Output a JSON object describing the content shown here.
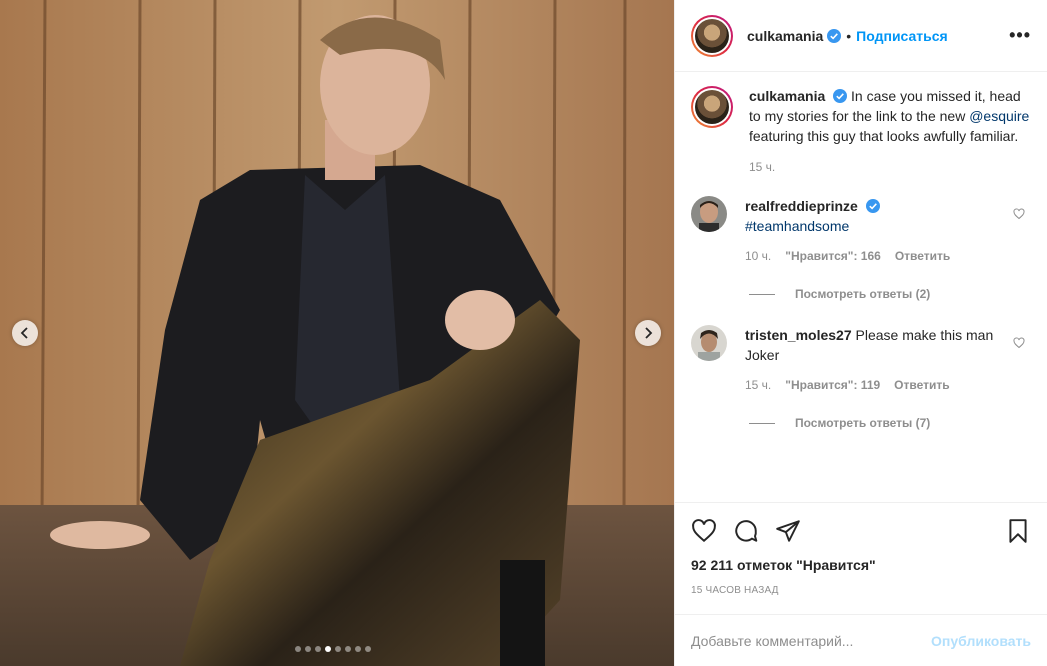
{
  "post": {
    "image_alt": "",
    "carousel": {
      "total": 8,
      "active_index": 3
    },
    "prev_icon": "chevron-left-icon",
    "next_icon": "chevron-right-icon"
  },
  "header": {
    "username": "culkamania",
    "verified_icon": "verified-badge-icon",
    "separator": "•",
    "follow_label": "Подписаться",
    "more_label": "•••"
  },
  "caption": {
    "username": "culkamania",
    "text_before": "In case you missed it, head to my stories for the link to the new ",
    "mention": "@esquire",
    "text_after": " featuring this guy that looks awfully familiar.",
    "time": "15 ч."
  },
  "comments": [
    {
      "username": "realfreddieprinze",
      "verified": true,
      "text": "#teamhandsome",
      "time": "10 ч.",
      "likes": "\"Нравится\": 166",
      "reply_label": "Ответить",
      "view_replies": "Посмотреть ответы (2)"
    },
    {
      "username": "tristen_moles27",
      "verified": false,
      "text": "Please make this man Joker",
      "time": "15 ч.",
      "likes": "\"Нравится\": 119",
      "reply_label": "Ответить",
      "view_replies": "Посмотреть ответы (7)"
    }
  ],
  "actions": {
    "like_icon": "heart-icon",
    "comment_icon": "comment-icon",
    "share_icon": "paper-plane-icon",
    "save_icon": "bookmark-icon",
    "likes_count": "92 211 отметок \"Нравится\"",
    "time_ago": "15 ЧАСОВ НАЗАД"
  },
  "add_comment": {
    "placeholder": "Добавьте комментарий...",
    "publish_label": "Опубликовать"
  },
  "colors": {
    "accent": "#0095f6",
    "muted": "#8e8e8e",
    "publish_disabled": "#b2dffc",
    "text": "#262626"
  }
}
